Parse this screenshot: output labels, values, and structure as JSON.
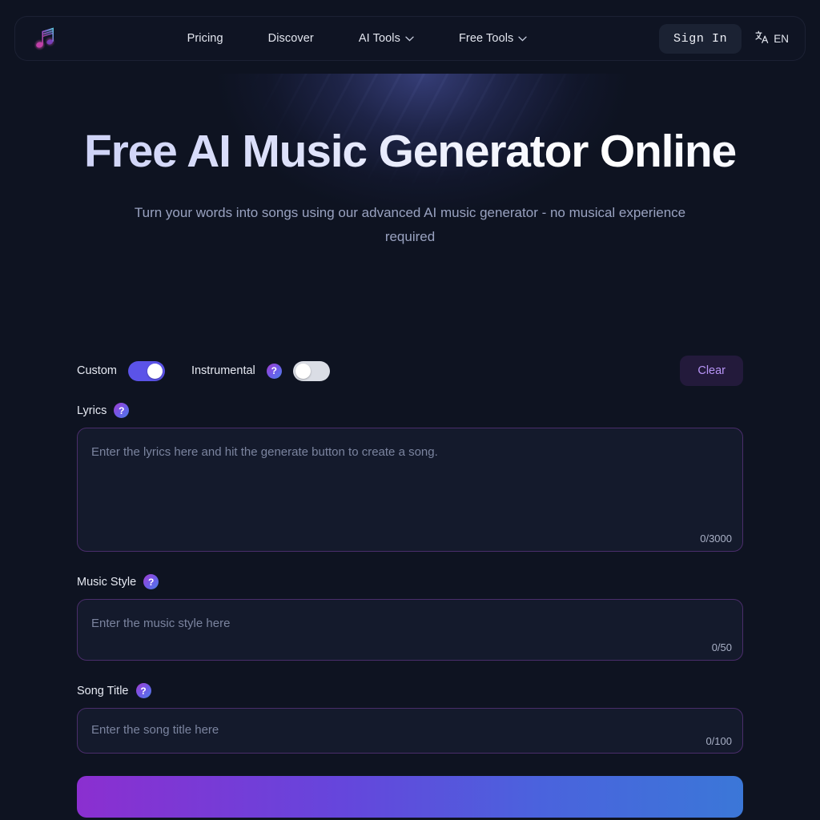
{
  "nav": {
    "logo_icon": "music-note-logo-icon",
    "links": [
      {
        "label": "Pricing",
        "has_chevron": false
      },
      {
        "label": "Discover",
        "has_chevron": false
      },
      {
        "label": "AI Tools",
        "has_chevron": true
      },
      {
        "label": "Free Tools",
        "has_chevron": true
      }
    ],
    "chevron_glyph": "⌄",
    "sign_in_label": "Sign In",
    "language_code": "EN",
    "language_icon": "translate-icon"
  },
  "hero": {
    "title": "Free AI Music Generator Online",
    "subtitle": "Turn your words into songs using our advanced AI music generator - no musical experience required"
  },
  "form": {
    "custom_label": "Custom",
    "custom_enabled": "on",
    "instrumental_label": "Instrumental",
    "instrumental_enabled": "off",
    "help_glyph": "?",
    "clear_label": "Clear",
    "lyrics": {
      "label": "Lyrics",
      "placeholder": "Enter the lyrics here and hit the generate button to create a song.",
      "value": "",
      "counter": "0/3000"
    },
    "music_style": {
      "label": "Music Style",
      "placeholder": "Enter the music style here",
      "value": "",
      "counter": "0/50"
    },
    "song_title": {
      "label": "Song Title",
      "placeholder": "Enter the song title here",
      "value": "",
      "counter": "0/100"
    },
    "generate_label": ""
  },
  "colors": {
    "page_background": "#0e1321",
    "accent_purple": "#5b53e8",
    "accent_clear_text": "#b794f6",
    "field_border": "#4a2d6b",
    "glow_blue": "#5660be"
  }
}
